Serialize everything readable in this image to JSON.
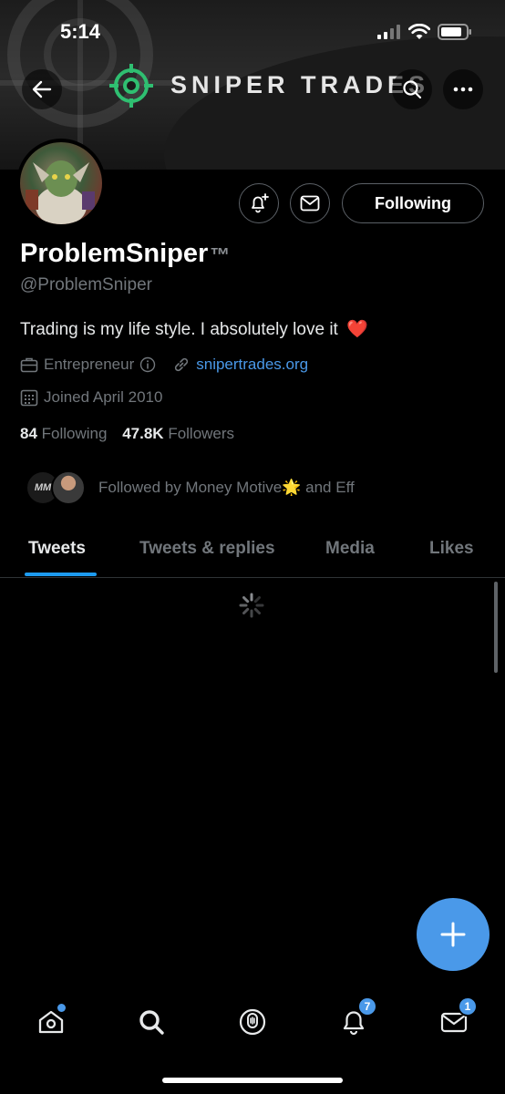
{
  "status_bar": {
    "time": "5:14"
  },
  "banner": {
    "brand_text": "SNIPER TRADES"
  },
  "profile": {
    "display_name": "ProblemSniper",
    "trademark": "™",
    "handle": "@ProblemSniper",
    "bio": "Trading is my life style. I absolutely love it",
    "bio_emoji": "❤️",
    "category": "Entrepreneur",
    "website": "snipertrades.org",
    "joined": "Joined April 2010",
    "following_count": "84",
    "following_label": "Following",
    "followers_count": "47.8K",
    "followers_label": "Followers",
    "followed_by": "Followed by Money Motive🌟  and Eff"
  },
  "actions": {
    "following_button": "Following"
  },
  "tabs": [
    {
      "label": "Tweets",
      "active": true
    },
    {
      "label": "Tweets & replies",
      "active": false
    },
    {
      "label": "Media",
      "active": false
    },
    {
      "label": "Likes",
      "active": false
    }
  ],
  "bottom_nav": {
    "notifications_badge": "7",
    "messages_badge": "1"
  },
  "colors": {
    "accent": "#1d9bf0",
    "fab": "#4a99e9",
    "link": "#4a99e9",
    "muted": "#71767b"
  }
}
